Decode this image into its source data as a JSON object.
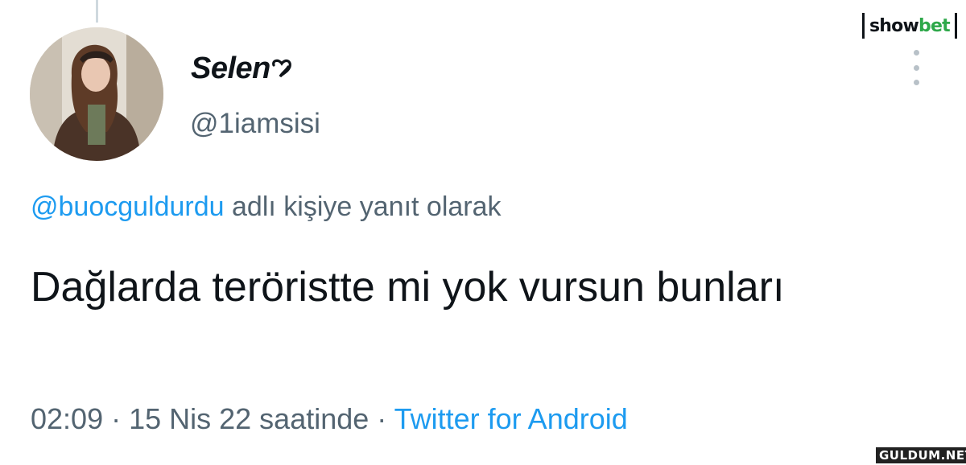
{
  "tweet": {
    "display_name": "Selen",
    "handle": "@1iamsisi",
    "reply_to_mention": "@buocguldurdu",
    "reply_suffix": " adlı kişiye yanıt olarak",
    "text": "Dağlarda teröristte mi yok vursun bunları",
    "time": "02:09",
    "separator": " · ",
    "date": "15 Nis 22 saatinde",
    "source": "Twitter for Android"
  },
  "icons": {
    "more": "more-vertical-icon",
    "name_suffix": "heart-doodle-icon",
    "avatar": "profile-photo"
  },
  "watermarks": {
    "showbet_part1": "show",
    "showbet_part2": "bet",
    "gulum": "GULDUM.NET"
  },
  "colors": {
    "link": "#1d9bf0",
    "secondary_text": "#536471",
    "primary_text": "#0f1419",
    "showbet_green": "#2ea84a"
  }
}
